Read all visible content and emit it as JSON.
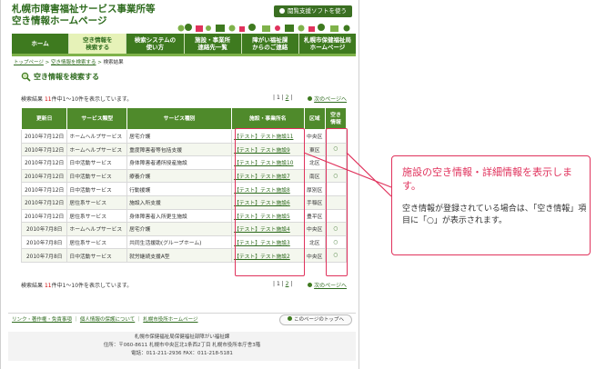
{
  "header": {
    "title_line1": "札幌市障害福祉サービス事業所等",
    "title_line2": "空き情報ホームページ",
    "assist_button": "閲覧支援ソフトを使う"
  },
  "nav": {
    "items": [
      {
        "label": "ホーム"
      },
      {
        "label": "空き情報を\n検索する"
      },
      {
        "label": "検索システムの\n使い方"
      },
      {
        "label": "施設・事業所\n連絡先一覧"
      },
      {
        "label": "障がい福祉課\nからのご連絡"
      },
      {
        "label": "札幌市保健福祉局\nホームページ"
      }
    ]
  },
  "breadcrumb": {
    "home": "トップページ",
    "search": "空き情報を検索する",
    "current": "検索結果"
  },
  "page_title": "空き情報を検索する",
  "results": {
    "prefix": "検索結果",
    "count": "11",
    "suffix": "件中1〜10件を表示しています。",
    "page1": "1",
    "page2": "2",
    "next": "次のページへ"
  },
  "table": {
    "headers": [
      "更新日",
      "サービス類型",
      "サービス種別",
      "施設・事業所名",
      "区域",
      "空き\n情報"
    ],
    "rows": [
      [
        "2010年7月12日",
        "ホームヘルプサービス",
        "居宅介護",
        "【テスト】テスト施設11",
        "中央区",
        ""
      ],
      [
        "2010年7月12日",
        "ホームヘルプサービス",
        "重度障害者等包括支援",
        "【テスト】テスト施設9",
        "東区",
        "○"
      ],
      [
        "2010年7月12日",
        "日中活動サービス",
        "身体障害者通所授産施設",
        "【テスト】テスト施設10",
        "北区",
        ""
      ],
      [
        "2010年7月12日",
        "日中活動サービス",
        "療養介護",
        "【テスト】テスト施設7",
        "南区",
        "○"
      ],
      [
        "2010年7月12日",
        "日中活動サービス",
        "行動援護",
        "【テスト】テスト施設8",
        "厚別区",
        ""
      ],
      [
        "2010年7月12日",
        "居住系サービス",
        "施設入所支援",
        "【テスト】テスト施設6",
        "手稲区",
        ""
      ],
      [
        "2010年7月12日",
        "居住系サービス",
        "身体障害者入所更生施設",
        "【テスト】テスト施設5",
        "豊平区",
        ""
      ],
      [
        "2010年7月8日",
        "ホームヘルプサービス",
        "居宅介護",
        "【テスト】テスト施設4",
        "中央区",
        "○"
      ],
      [
        "2010年7月8日",
        "居住系サービス",
        "共同生活援助(グループホーム)",
        "【テスト】テスト施設3",
        "北区",
        "○"
      ],
      [
        "2010年7月8日",
        "日中活動サービス",
        "就労継続支援A型",
        "【テスト】テスト施設2",
        "中央区",
        "○"
      ]
    ]
  },
  "footer": {
    "links": [
      "リンク・著作権・免責事項",
      "個人情報の保護について",
      "札幌市役所ホームページ"
    ],
    "separator": "｜",
    "top_button": "このページのトップへ",
    "addr_line1": "札幌市保健福祉局保健福祉部障がい福祉課",
    "addr_line2": "住所：〒060-8611 札幌市中央区北1条西2丁目 札幌市役所本庁舎3階",
    "addr_line3": "電話：011-211-2936 FAX：011-218-5181"
  },
  "callout": {
    "title": "施設の空き情報・詳細情報を表示します。",
    "body": "空き情報が登録されている場合は、「空き情報」項目に「○」が表示されます。"
  },
  "colors": {
    "brand_green": "#3e7a1f",
    "highlight": "#e0325c"
  }
}
